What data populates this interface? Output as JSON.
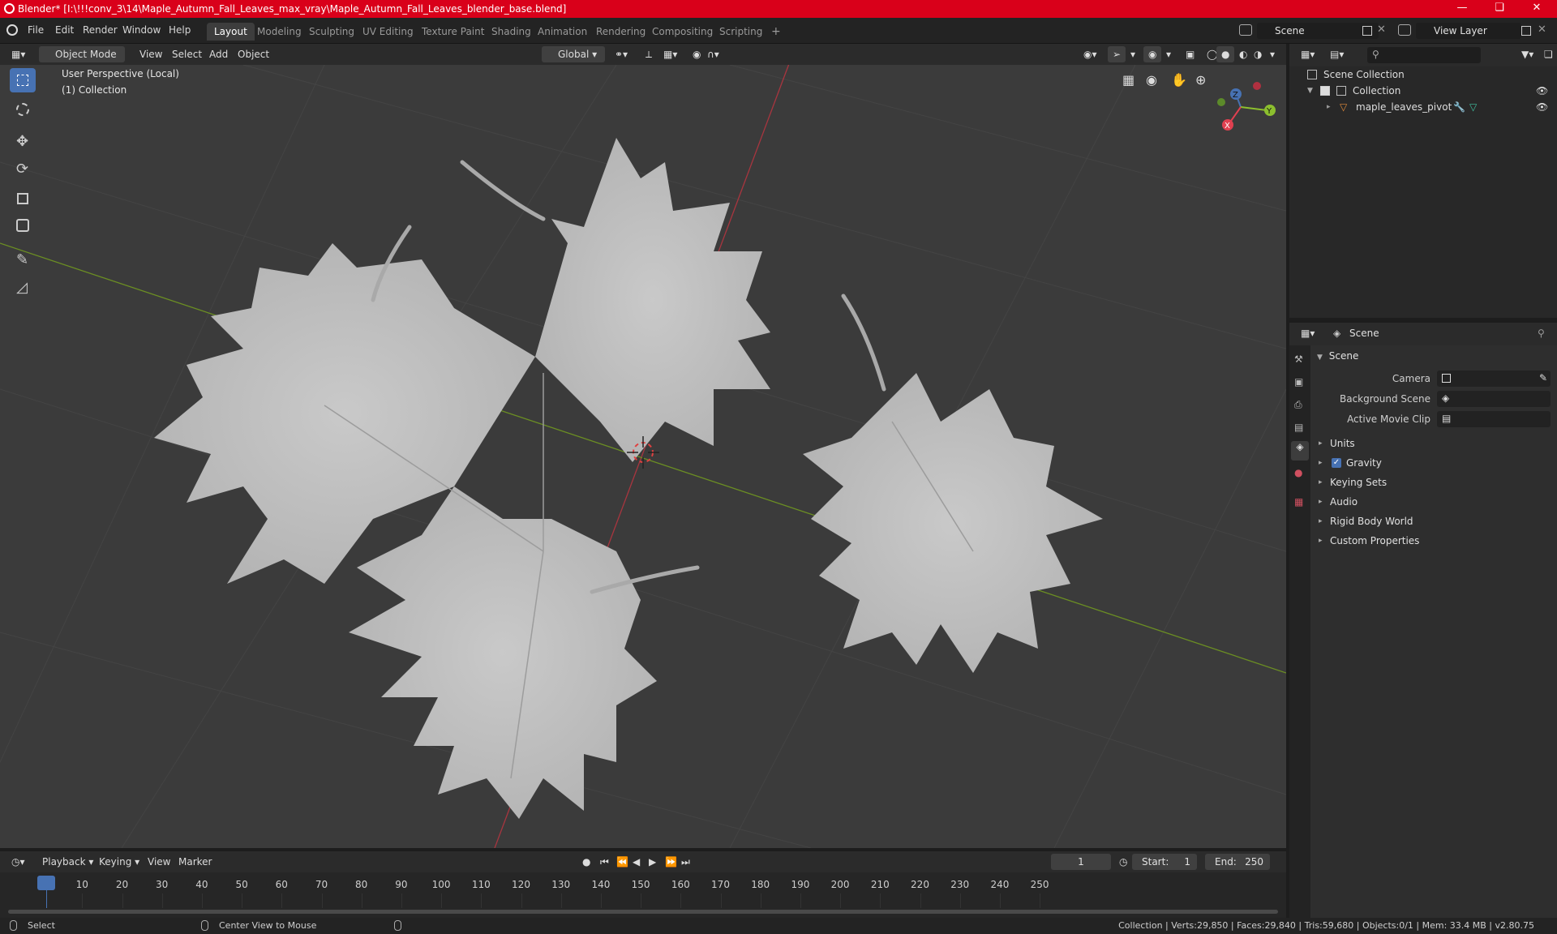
{
  "window": {
    "title": "Blender* [I:\\!!!conv_3\\14\\Maple_Autumn_Fall_Leaves_max_vray\\Maple_Autumn_Fall_Leaves_blender_base.blend]",
    "title_bar_color": "#d9001a"
  },
  "menu": {
    "items": [
      "File",
      "Edit",
      "Render",
      "Window",
      "Help"
    ],
    "workspaces": [
      "Layout",
      "Modeling",
      "Sculpting",
      "UV Editing",
      "Texture Paint",
      "Shading",
      "Animation",
      "Rendering",
      "Compositing",
      "Scripting"
    ],
    "active_workspace": "Layout",
    "add_workspace": "+",
    "scene_name": "Scene",
    "view_layer": "View Layer"
  },
  "viewport_header": {
    "mode": "Object Mode",
    "menus": [
      "View",
      "Select",
      "Add",
      "Object"
    ],
    "orientation": "Global"
  },
  "viewport": {
    "perspective_label": "User Perspective (Local)",
    "collection_label": "(1) Collection",
    "gizmo_axes": [
      "X",
      "Y",
      "Z"
    ],
    "background_color": "#3b3b3b",
    "accent_color": "#4772b3"
  },
  "outliner": {
    "root": "Scene Collection",
    "collection": "Collection",
    "object": "maple_leaves_pivot"
  },
  "properties": {
    "context_label": "Scene",
    "panel_title": "Scene",
    "fields": [
      {
        "label": "Camera"
      },
      {
        "label": "Background Scene"
      },
      {
        "label": "Active Movie Clip"
      }
    ],
    "subpanels": [
      "Units",
      "Gravity",
      "Keying Sets",
      "Audio",
      "Rigid Body World",
      "Custom Properties"
    ],
    "gravity_checked": true
  },
  "timeline": {
    "menus": [
      "Playback",
      "Keying",
      "View",
      "Marker"
    ],
    "current_frame": "1",
    "start_label": "Start:",
    "start": "1",
    "end_label": "End:",
    "end": "250",
    "ticks": [
      "1",
      "10",
      "20",
      "30",
      "40",
      "50",
      "60",
      "70",
      "80",
      "90",
      "100",
      "110",
      "120",
      "130",
      "140",
      "150",
      "160",
      "170",
      "180",
      "190",
      "200",
      "210",
      "220",
      "230",
      "240",
      "250"
    ]
  },
  "statusbar": {
    "select": "Select",
    "center_view": "Center View to Mouse",
    "stats": "Collection | Verts:29,850 | Faces:29,840 | Tris:59,680 | Objects:0/1 | Mem: 33.4 MB | v2.80.75"
  }
}
